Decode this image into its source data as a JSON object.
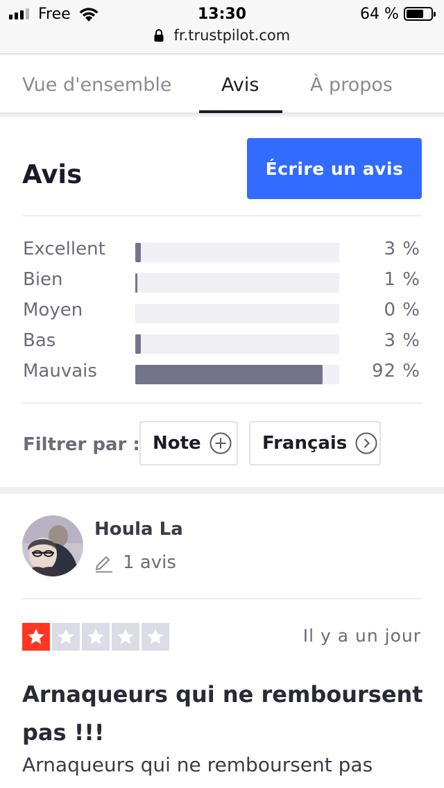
{
  "status_bar": {
    "carrier": "Free",
    "time": "13:30",
    "battery_percent": "64 %",
    "battery_level": 0.64
  },
  "browser": {
    "url": "fr.trustpilot.com"
  },
  "tabs": [
    {
      "label": "Vue d'ensemble",
      "active": false
    },
    {
      "label": "Avis",
      "active": true
    },
    {
      "label": "À propos",
      "active": false
    }
  ],
  "reviews_header": {
    "title": "Avis",
    "write_button_label": "Écrire un avis"
  },
  "rating_distribution": [
    {
      "label": "Excellent",
      "percent_label": "3 %",
      "percent": 3
    },
    {
      "label": "Bien",
      "percent_label": "1 %",
      "percent": 1
    },
    {
      "label": "Moyen",
      "percent_label": "0 %",
      "percent": 0
    },
    {
      "label": "Bas",
      "percent_label": "3 %",
      "percent": 3
    },
    {
      "label": "Mauvais",
      "percent_label": "92 %",
      "percent": 92
    }
  ],
  "filters": {
    "label": "Filtrer par :",
    "note_label": "Note",
    "language_label": "Français"
  },
  "review": {
    "reviewer_name": "Houla La",
    "reviewer_review_count": "1 avis",
    "stars": 1,
    "date": "Il y a un jour",
    "title": "Arnaqueurs qui ne remboursent pas !!!",
    "body": "Arnaqueurs qui ne remboursent pas"
  },
  "colors": {
    "accent": "#316bff",
    "bar": "#73738c",
    "star_red": "#ff3722"
  }
}
